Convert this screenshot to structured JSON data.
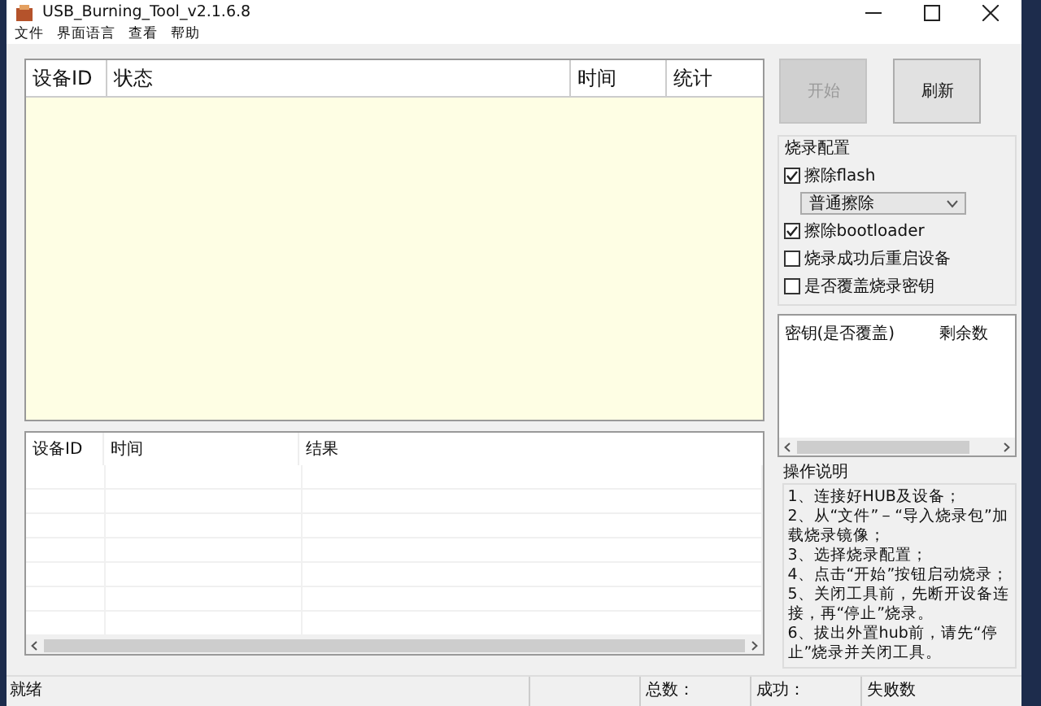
{
  "window": {
    "title": "USB_Burning_Tool_v2.1.6.8"
  },
  "menu": [
    "文件",
    "界面语言",
    "查看",
    "帮助"
  ],
  "device_table": {
    "columns": [
      "设备ID",
      "状态",
      "时间",
      "统计"
    ]
  },
  "log_table": {
    "columns": [
      "设备ID",
      "时间",
      "结果"
    ]
  },
  "buttons": [
    {
      "label": "开始",
      "disabled": true
    },
    {
      "label": "刷新",
      "disabled": false
    }
  ],
  "burn_config": {
    "title": "烧录配置",
    "options": [
      {
        "kind": "checkbox",
        "label": "擦除flash",
        "checked": true
      },
      {
        "kind": "select",
        "value": "普通擦除"
      },
      {
        "kind": "checkbox",
        "label": "擦除bootloader",
        "checked": true
      },
      {
        "kind": "checkbox",
        "label": "烧录成功后重启设备",
        "checked": false
      },
      {
        "kind": "checkbox",
        "label": "是否覆盖烧录密钥",
        "checked": false
      }
    ]
  },
  "key_table": {
    "columns": [
      "密钥(是否覆盖)",
      "剩余数"
    ]
  },
  "instructions": {
    "title": "操作说明",
    "lines": [
      "1、连接好HUB及设备；",
      "2、从“文件”－“导入烧录包”加载烧录镜像；",
      "3、选择烧录配置；",
      "4、点击“开始”按钮启动烧录；",
      "5、关闭工具前，先断开设备连接，再“停止”烧录。",
      "6、拔出外置hub前，请先“停止”烧录并关闭工具。"
    ]
  },
  "status_bar": {
    "status": "就绪",
    "total": "总数：",
    "success": "成功：",
    "failed": "失败数"
  }
}
